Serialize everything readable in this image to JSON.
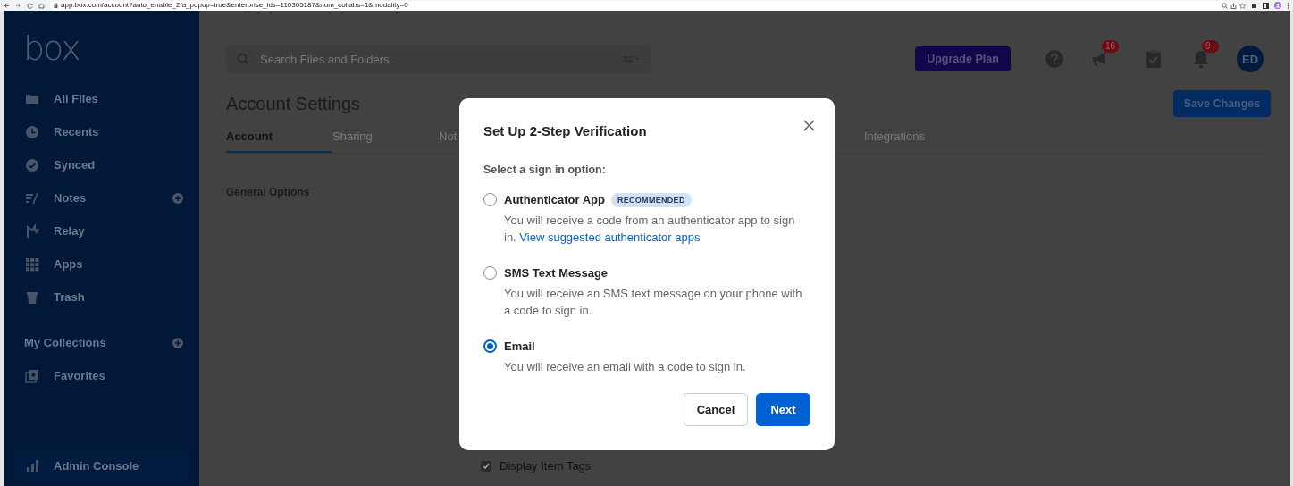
{
  "browser": {
    "url": "app.box.com/account?auto_enable_2fa_popup=true&enterprise_ids=110305187&num_collabs=1&modality=0"
  },
  "sidebar": {
    "logo": "box",
    "items": [
      {
        "label": "All Files",
        "add": false
      },
      {
        "label": "Recents",
        "add": false
      },
      {
        "label": "Synced",
        "add": false
      },
      {
        "label": "Notes",
        "add": true
      },
      {
        "label": "Relay",
        "add": false
      },
      {
        "label": "Apps",
        "add": false
      },
      {
        "label": "Trash",
        "add": false
      }
    ],
    "collections": {
      "label": "My Collections",
      "add": true
    },
    "collection_items": [
      {
        "label": "Favorites"
      }
    ],
    "admin": {
      "label": "Admin Console"
    }
  },
  "header": {
    "search": {
      "placeholder": "Search Files and Folders"
    },
    "upgrade_button": "Upgrade Plan",
    "announcements_badge": "16",
    "notifications_badge": "9+",
    "avatar": "ED"
  },
  "content": {
    "title": "Account Settings",
    "save_button": "Save Changes",
    "tabs": [
      {
        "label": "Account",
        "selected": true
      },
      {
        "label": "Sharing",
        "selected": false
      },
      {
        "label": "Not",
        "selected": false
      },
      {
        "label": "Integrations",
        "selected": false
      }
    ],
    "section": "General Options",
    "checkbox": {
      "label": "Display Item Tags",
      "checked": true
    }
  },
  "dialog": {
    "title": "Set Up 2-Step Verification",
    "prompt": "Select a sign in option:",
    "options": [
      {
        "label": "Authenticator App",
        "badge": "RECOMMENDED",
        "description": "You will receive a code from an authenticator app to sign in.",
        "link": "View suggested authenticator apps",
        "selected": false
      },
      {
        "label": "SMS Text Message",
        "description": "You will receive an SMS text message on your phone with a code to sign in.",
        "selected": false
      },
      {
        "label": "Email",
        "description": "You will receive an email with a code to sign in.",
        "selected": true
      }
    ],
    "cancel_button": "Cancel",
    "next_button": "Next"
  }
}
